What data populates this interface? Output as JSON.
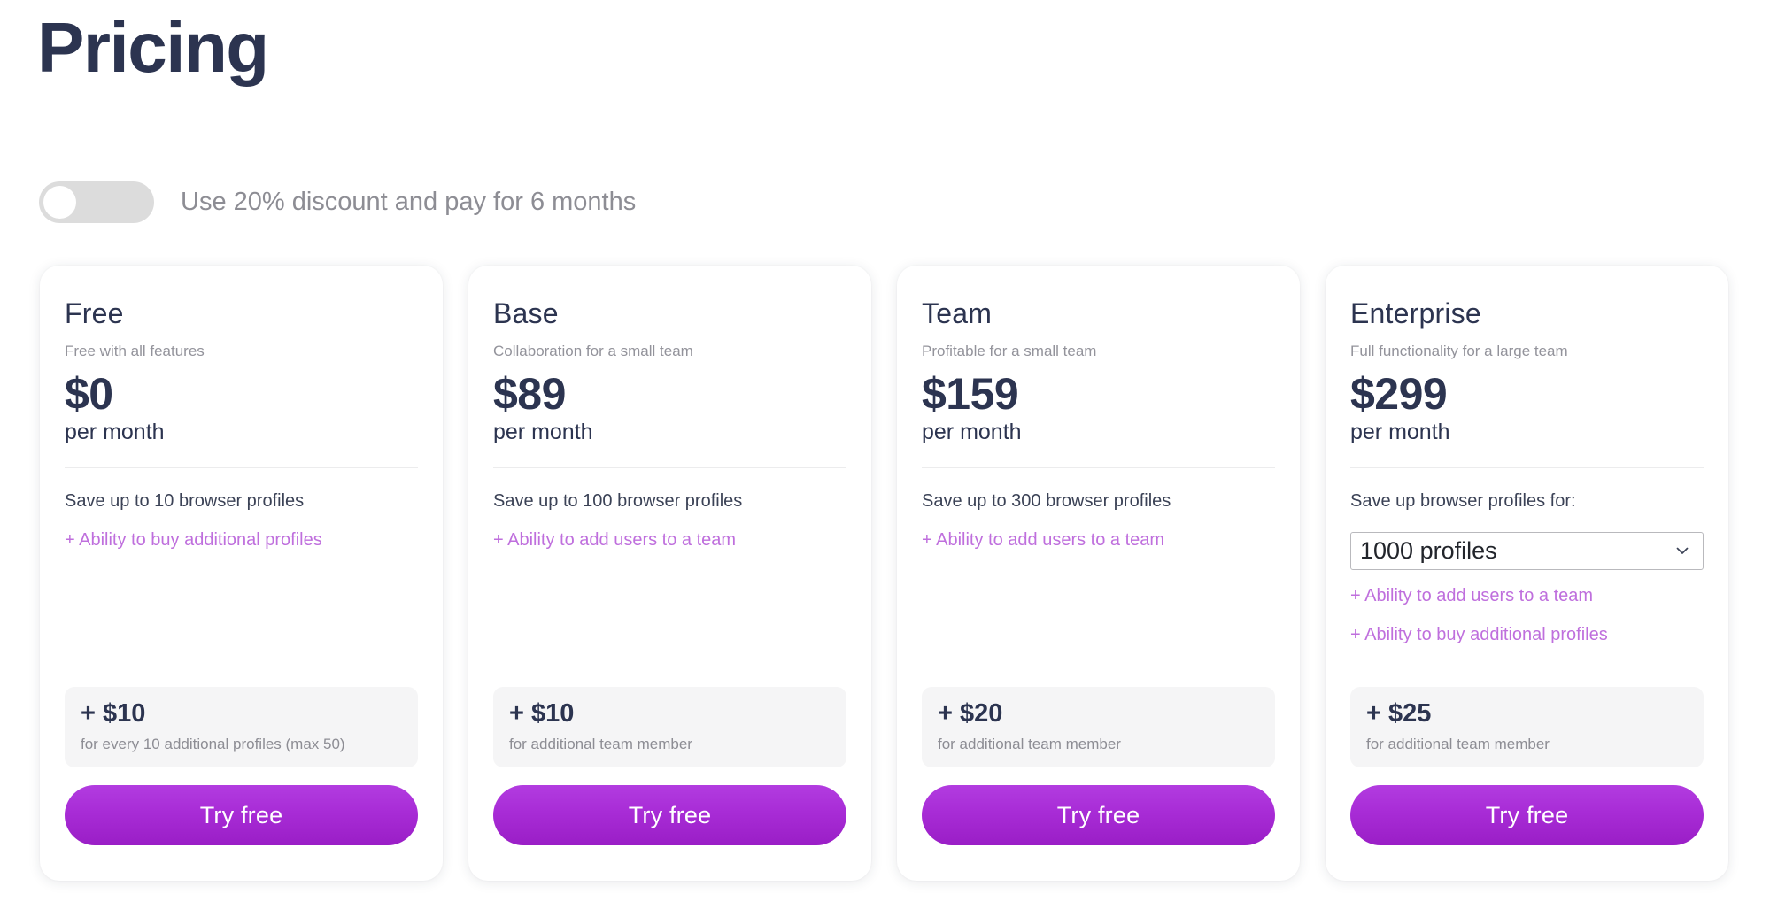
{
  "page": {
    "title": "Pricing",
    "accent_color": "#bf6fdd",
    "title_color": "#2c3450",
    "button_gradient_from": "#b23ce0",
    "button_gradient_to": "#9a1ec6",
    "addon_box_color": "#f5f5f6",
    "toggle_track_color": "#dcdcdc"
  },
  "discount_toggle": {
    "label": "Use 20% discount and pay for 6 months",
    "state": "off",
    "icon": "toggle-switch-icon"
  },
  "plans": [
    {
      "name": "Free",
      "tagline": "Free with all features",
      "price": "$0",
      "period": "per month",
      "features": [
        {
          "text": "Save up to 10 browser profiles",
          "accent": false
        },
        {
          "text": "+ Ability to buy additional profiles",
          "accent": true
        }
      ],
      "addon": {
        "price": "+ $10",
        "note": "for every 10 additional profiles (max 50)"
      },
      "cta_label": "Try free"
    },
    {
      "name": "Base",
      "tagline": "Collaboration for a small team",
      "price": "$89",
      "period": "per month",
      "features": [
        {
          "text": "Save up to 100 browser profiles",
          "accent": false
        },
        {
          "text": "+ Ability to add users to a team",
          "accent": true
        }
      ],
      "addon": {
        "price": "+ $10",
        "note": "for additional team member"
      },
      "cta_label": "Try free"
    },
    {
      "name": "Team",
      "tagline": "Profitable for a small team",
      "price": "$159",
      "period": "per month",
      "features": [
        {
          "text": "Save up to 300 browser profiles",
          "accent": false
        },
        {
          "text": "+ Ability to add users to a team",
          "accent": true
        }
      ],
      "addon": {
        "price": "+ $20",
        "note": "for additional team member"
      },
      "cta_label": "Try free"
    },
    {
      "name": "Enterprise",
      "tagline": "Full functionality for a large team",
      "price": "$299",
      "period": "per month",
      "select_label": "Save up browser profiles for:",
      "select_value": "1000 profiles",
      "select_icon": "chevron-down-icon",
      "features": [
        {
          "text": "+ Ability to add users to a team",
          "accent": true
        },
        {
          "text": "+ Ability to buy additional profiles",
          "accent": true
        }
      ],
      "addon": {
        "price": "+ $25",
        "note": "for additional team member"
      },
      "cta_label": "Try free"
    }
  ]
}
